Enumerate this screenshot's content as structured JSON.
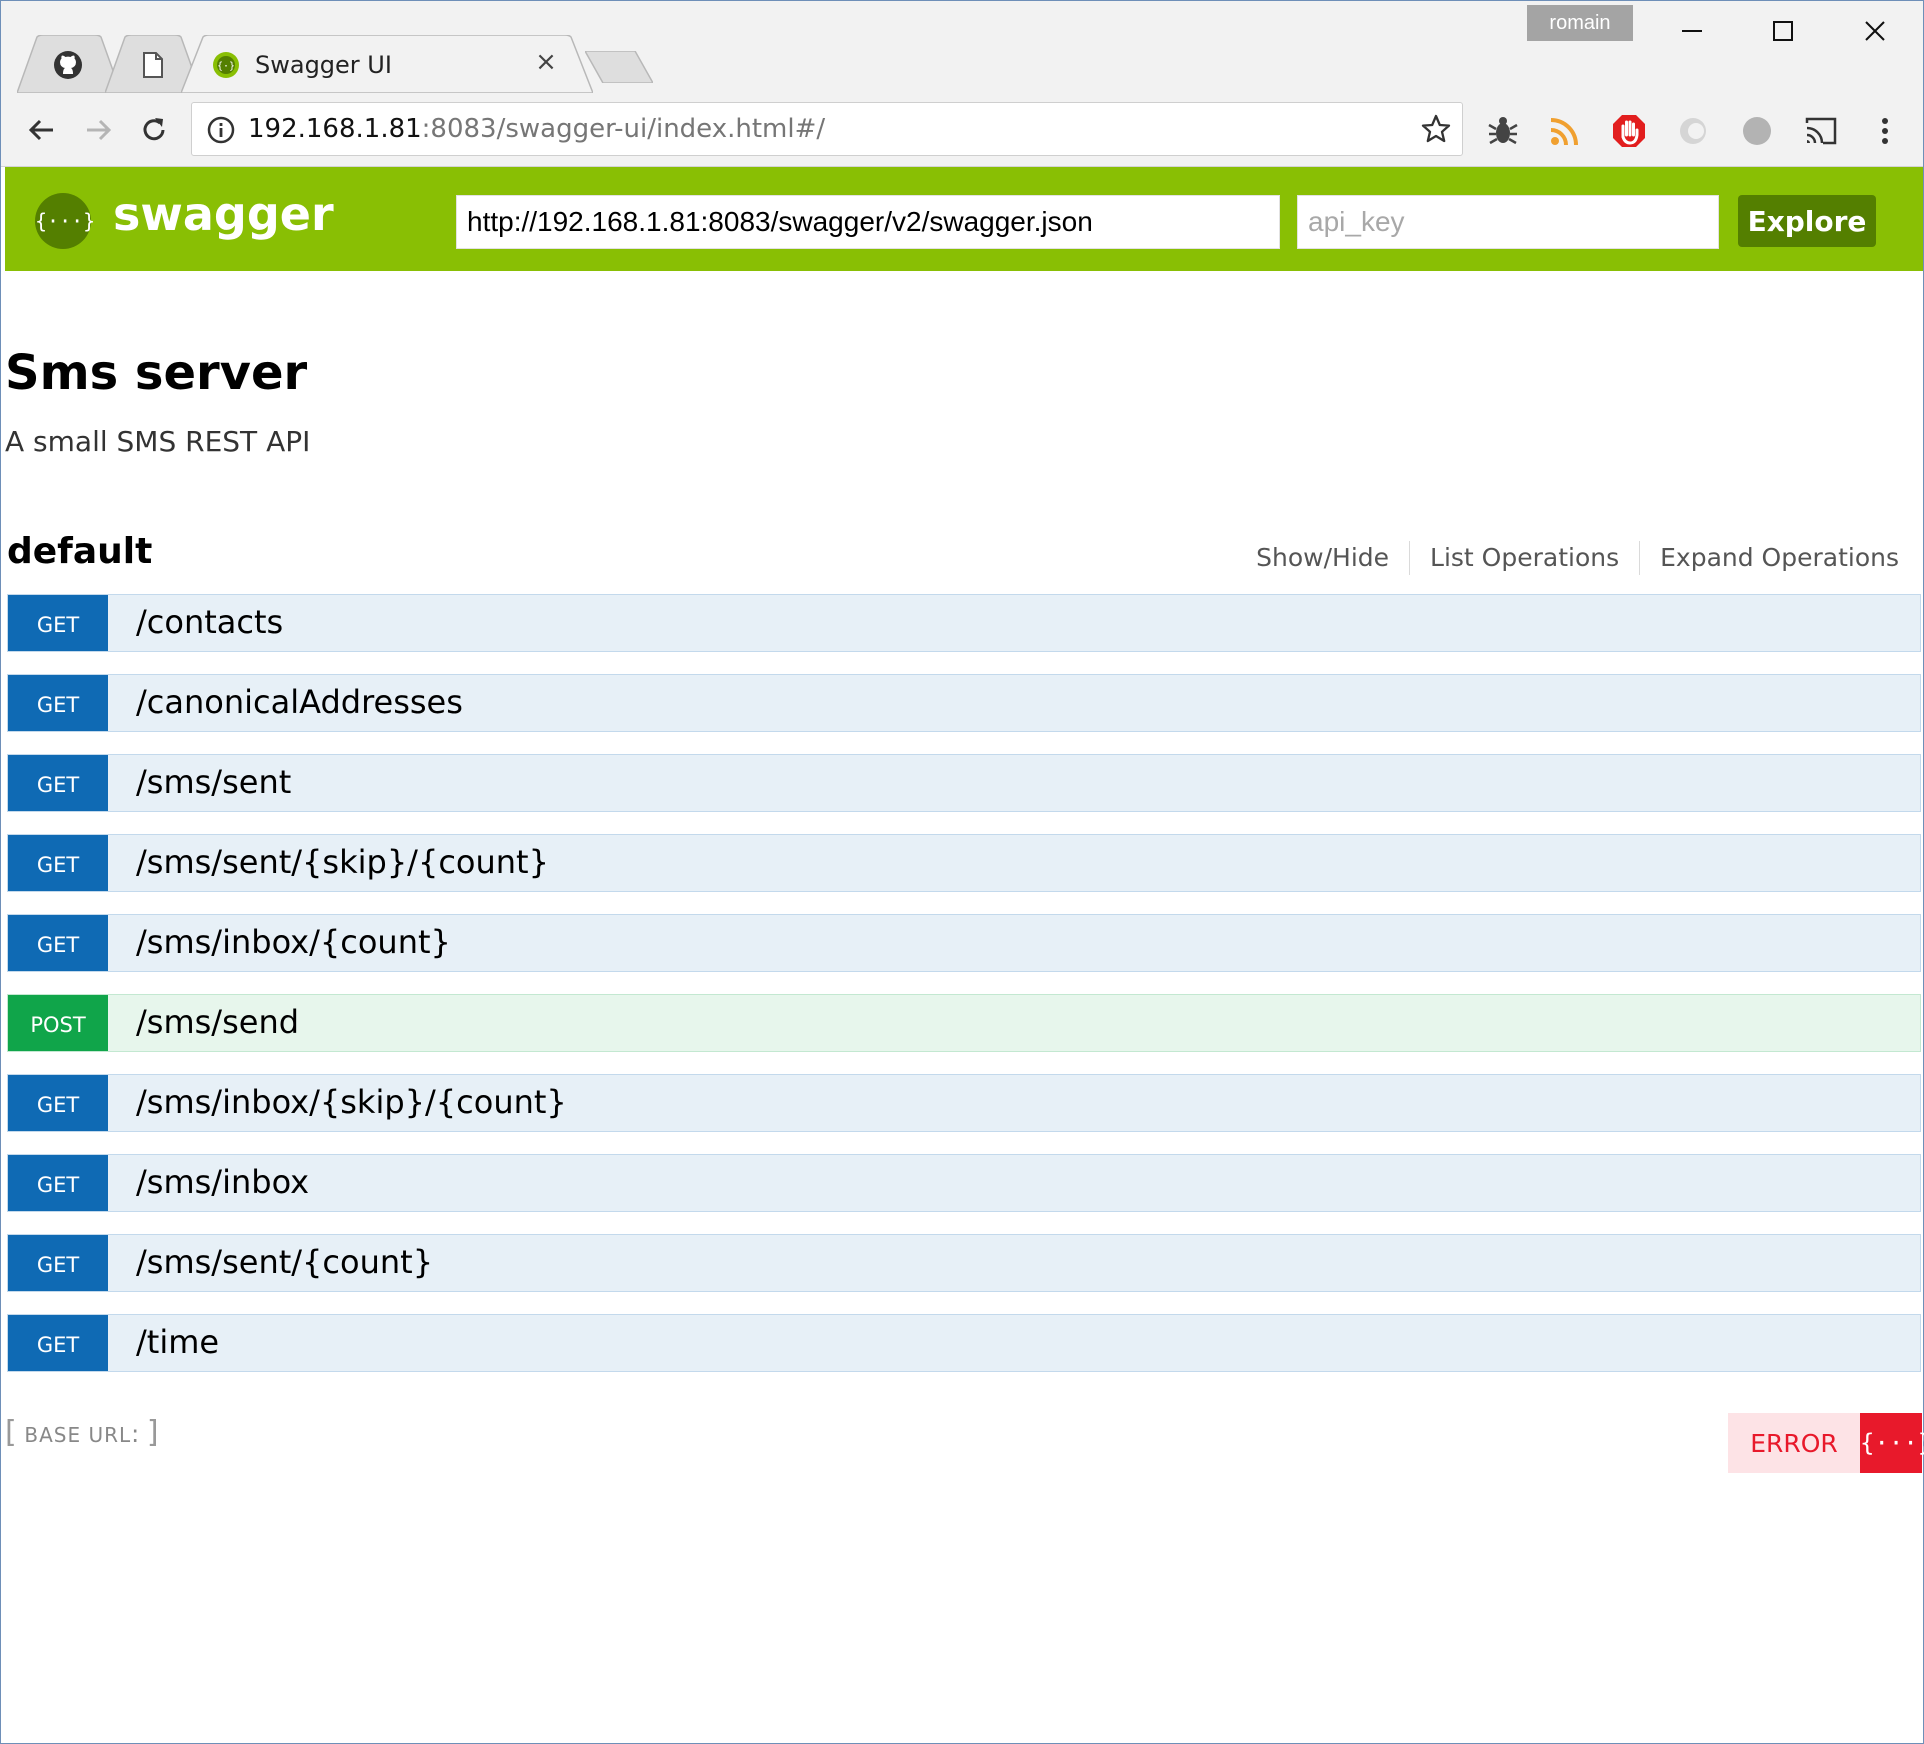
{
  "browser": {
    "tabs": [
      {
        "icon": "github-icon"
      },
      {
        "icon": "document-icon"
      },
      {
        "label": "Swagger UI",
        "icon": "swagger-favicon-icon",
        "active": true
      }
    ],
    "close_glyph": "×",
    "profile_name": "romain",
    "url_host": "192.168.1.81",
    "url_rest": ":8083/swagger-ui/index.html#/"
  },
  "header": {
    "title": "swagger",
    "logo_glyph": "{···}",
    "spec_url": "http://192.168.1.81:8083/swagger/v2/swagger.json",
    "api_key_placeholder": "api_key",
    "explore_label": "Explore",
    "brand_color": "#89bf04"
  },
  "info": {
    "title": "Sms server",
    "description": "A small SMS REST API"
  },
  "group": {
    "name": "default",
    "links": [
      "Show/Hide",
      "List Operations",
      "Expand Operations"
    ]
  },
  "operations": [
    {
      "method": "GET",
      "path": "/contacts"
    },
    {
      "method": "GET",
      "path": "/canonicalAddresses"
    },
    {
      "method": "GET",
      "path": "/sms/sent"
    },
    {
      "method": "GET",
      "path": "/sms/sent/{skip}/{count}"
    },
    {
      "method": "GET",
      "path": "/sms/inbox/{count}"
    },
    {
      "method": "POST",
      "path": "/sms/send"
    },
    {
      "method": "GET",
      "path": "/sms/inbox/{skip}/{count}"
    },
    {
      "method": "GET",
      "path": "/sms/inbox"
    },
    {
      "method": "GET",
      "path": "/sms/sent/{count}"
    },
    {
      "method": "GET",
      "path": "/time"
    }
  ],
  "footer": {
    "base_url_open": "[",
    "base_url_label": "BASE URL",
    "base_url_colon": ":",
    "base_url_close": "]",
    "validator_label": "ERROR",
    "validator_glyph": "{···}"
  }
}
